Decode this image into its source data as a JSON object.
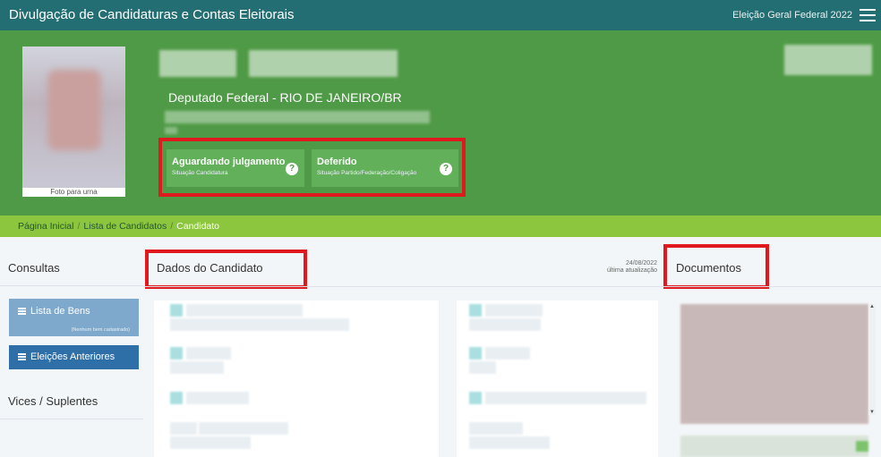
{
  "topbar": {
    "title": "Divulgação de Candidaturas e Contas Eleitorais",
    "election": "Eleição Geral Federal 2022",
    "menu_icon": "hamburger-icon"
  },
  "candidate": {
    "photo_caption": "Foto para urna",
    "office": "Deputado Federal - RIO DE JANEIRO/BR",
    "status": [
      {
        "label": "Aguardando julgamento",
        "sublabel": "Situação Candidatura"
      },
      {
        "label": "Deferido",
        "sublabel": "Situação Partido/Federação/Coligação"
      }
    ]
  },
  "breadcrumb": {
    "items": [
      "Página Inicial",
      "Lista de Candidatos",
      "Candidato"
    ],
    "separator": "/"
  },
  "sidebar": {
    "consultas_title": "Consultas",
    "bens_button": "Lista de Bens",
    "bens_note": "(Nenhum bem cadastrado)",
    "eleicoes_button": "Eleições Anteriores",
    "vices_title": "Vices / Suplentes"
  },
  "main": {
    "dados_title": "Dados do Candidato",
    "update_date": "24/08/2022",
    "update_label": "última atualização",
    "documentos_title": "Documentos"
  },
  "colors": {
    "topbar": "#236e72",
    "header": "#4f9a46",
    "breadcrumb": "#8cc63f",
    "highlight": "#e0191f"
  }
}
